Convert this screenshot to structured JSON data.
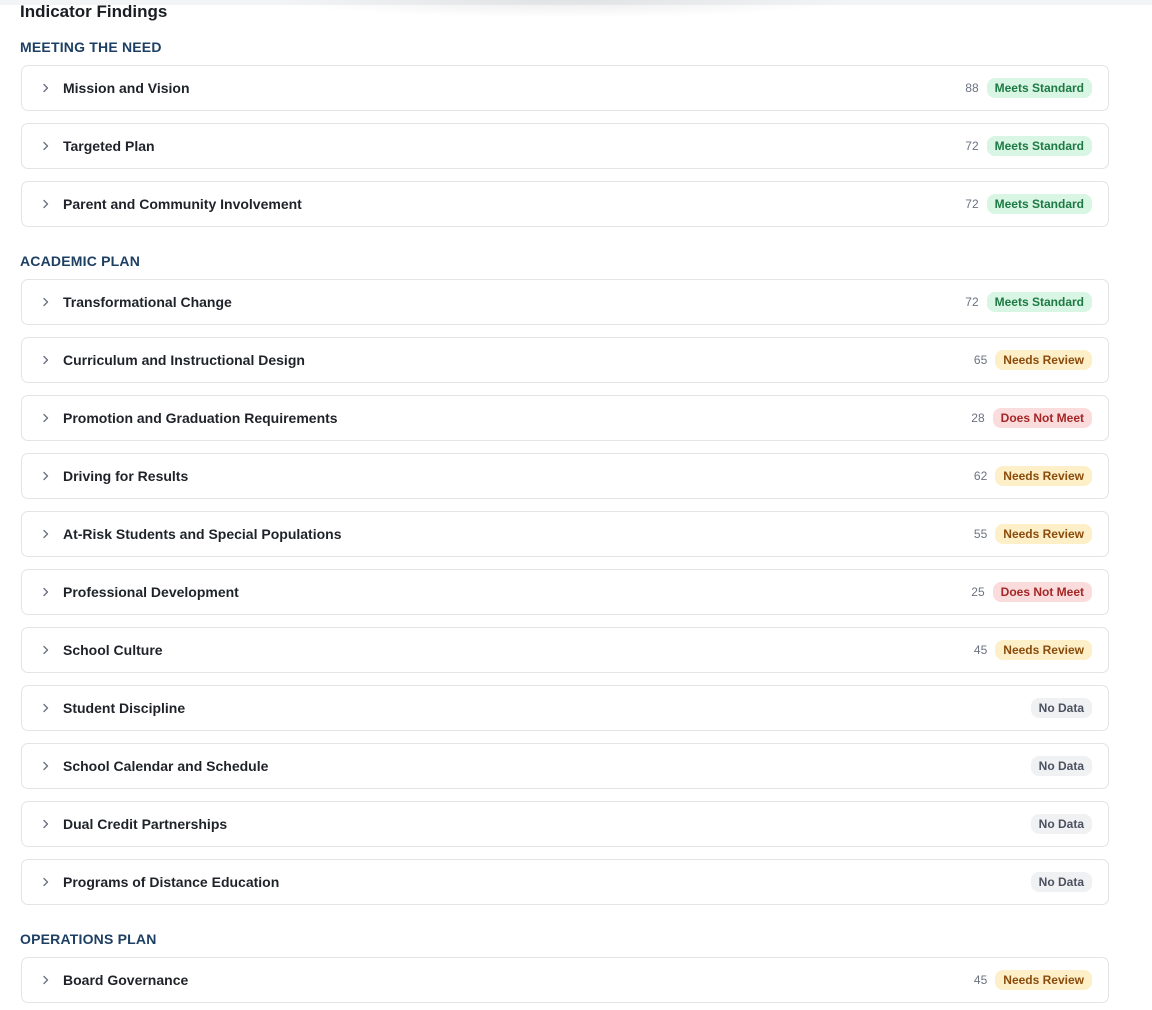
{
  "page": {
    "title": "Indicator Findings"
  },
  "sections": [
    {
      "heading": "MEETING THE NEED",
      "rows": [
        {
          "label": "Mission and Vision",
          "score": "88",
          "status": "Meets Standard"
        },
        {
          "label": "Targeted Plan",
          "score": "72",
          "status": "Meets Standard"
        },
        {
          "label": "Parent and Community Involvement",
          "score": "72",
          "status": "Meets Standard"
        }
      ]
    },
    {
      "heading": "ACADEMIC PLAN",
      "rows": [
        {
          "label": "Transformational Change",
          "score": "72",
          "status": "Meets Standard"
        },
        {
          "label": "Curriculum and Instructional Design",
          "score": "65",
          "status": "Needs Review"
        },
        {
          "label": "Promotion and Graduation Requirements",
          "score": "28",
          "status": "Does Not Meet"
        },
        {
          "label": "Driving for Results",
          "score": "62",
          "status": "Needs Review"
        },
        {
          "label": "At-Risk Students and Special Populations",
          "score": "55",
          "status": "Needs Review"
        },
        {
          "label": "Professional Development",
          "score": "25",
          "status": "Does Not Meet"
        },
        {
          "label": "School Culture",
          "score": "45",
          "status": "Needs Review"
        },
        {
          "label": "Student Discipline",
          "score": "",
          "status": "No Data"
        },
        {
          "label": "School Calendar and Schedule",
          "score": "",
          "status": "No Data"
        },
        {
          "label": "Dual Credit Partnerships",
          "score": "",
          "status": "No Data"
        },
        {
          "label": "Programs of Distance Education",
          "score": "",
          "status": "No Data"
        }
      ]
    },
    {
      "heading": "OPERATIONS PLAN",
      "rows": [
        {
          "label": "Board Governance",
          "score": "45",
          "status": "Needs Review"
        }
      ]
    }
  ],
  "status_colors": {
    "Meets Standard": {
      "bg": "#d9f5e3",
      "fg": "#1d7a44"
    },
    "Needs Review": {
      "bg": "#fdf0c8",
      "fg": "#8a4b0c"
    },
    "Does Not Meet": {
      "bg": "#fbdcdc",
      "fg": "#a52626"
    },
    "No Data": {
      "bg": "#f0f1f3",
      "fg": "#4b5160"
    }
  },
  "icons": {
    "row_toggle": "chevron-right-icon"
  }
}
